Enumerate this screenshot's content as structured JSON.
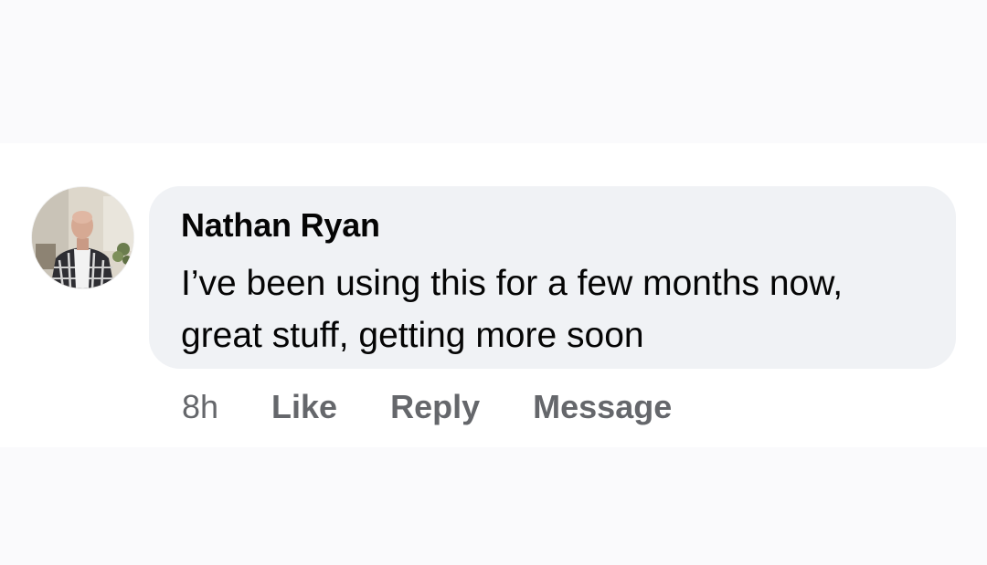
{
  "comment": {
    "author": "Nathan Ryan",
    "text": "I’ve been using this for a few months now, great stuff, getting more soon",
    "timestamp": "8h",
    "actions": {
      "like": "Like",
      "reply": "Reply",
      "message": "Message"
    }
  },
  "colors": {
    "bubble_background": "#f0f2f5",
    "author_text": "#050505",
    "action_text": "#65676b"
  },
  "icons": {
    "avatar": "profile-photo"
  }
}
